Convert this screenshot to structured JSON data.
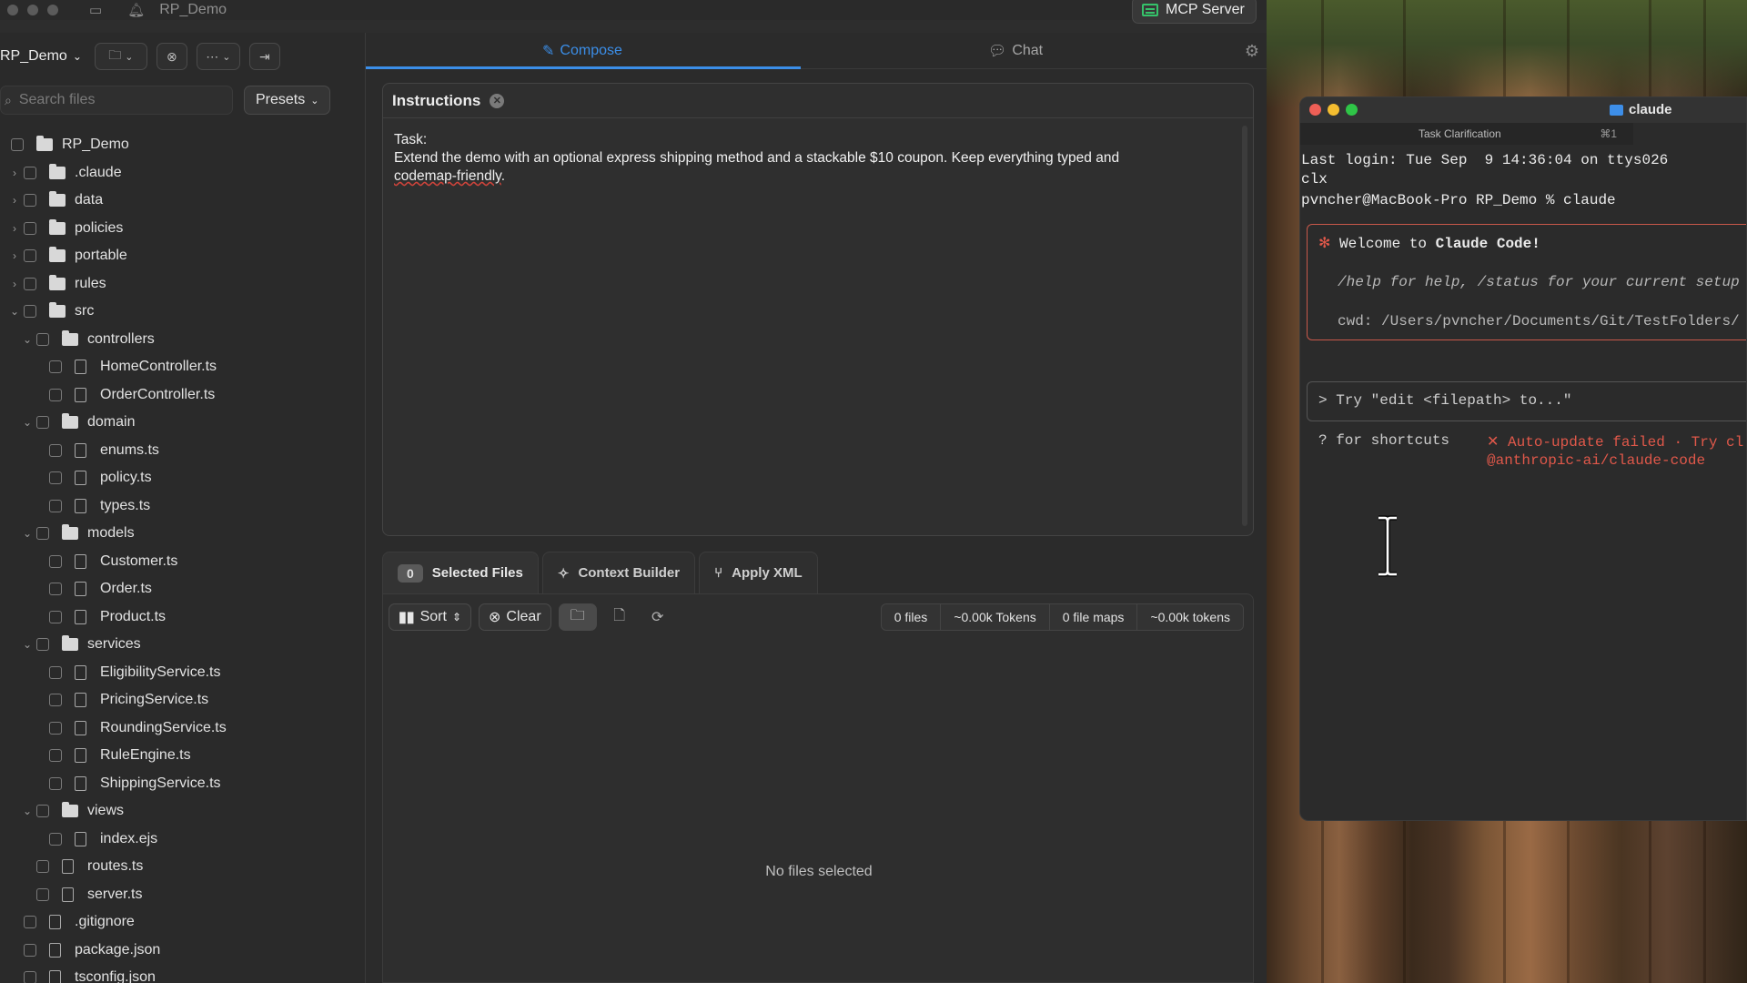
{
  "window": {
    "title": "RP_Demo",
    "mcp_label": "MCP Server"
  },
  "toolbar": {
    "project": "RP_Demo"
  },
  "search": {
    "placeholder": "Search files",
    "presets_label": "Presets"
  },
  "tree": [
    {
      "label": "RP_Demo",
      "type": "folder",
      "depth": 0,
      "expand": "",
      "top": 0
    },
    {
      "label": ".claude",
      "type": "folder",
      "depth": 1,
      "expand": "›"
    },
    {
      "label": "data",
      "type": "folder",
      "depth": 1,
      "expand": "›"
    },
    {
      "label": "policies",
      "type": "folder",
      "depth": 1,
      "expand": "›"
    },
    {
      "label": "portable",
      "type": "folder",
      "depth": 1,
      "expand": "›"
    },
    {
      "label": "rules",
      "type": "folder",
      "depth": 1,
      "expand": "›"
    },
    {
      "label": "src",
      "type": "folder",
      "depth": 1,
      "expand": "⌄"
    },
    {
      "label": "controllers",
      "type": "folder",
      "depth": 2,
      "expand": "⌄"
    },
    {
      "label": "HomeController.ts",
      "type": "file",
      "depth": 3,
      "expand": ""
    },
    {
      "label": "OrderController.ts",
      "type": "file",
      "depth": 3,
      "expand": ""
    },
    {
      "label": "domain",
      "type": "folder",
      "depth": 2,
      "expand": "⌄"
    },
    {
      "label": "enums.ts",
      "type": "file",
      "depth": 3,
      "expand": ""
    },
    {
      "label": "policy.ts",
      "type": "file",
      "depth": 3,
      "expand": ""
    },
    {
      "label": "types.ts",
      "type": "file",
      "depth": 3,
      "expand": ""
    },
    {
      "label": "models",
      "type": "folder",
      "depth": 2,
      "expand": "⌄"
    },
    {
      "label": "Customer.ts",
      "type": "file",
      "depth": 3,
      "expand": ""
    },
    {
      "label": "Order.ts",
      "type": "file",
      "depth": 3,
      "expand": ""
    },
    {
      "label": "Product.ts",
      "type": "file",
      "depth": 3,
      "expand": ""
    },
    {
      "label": "services",
      "type": "folder",
      "depth": 2,
      "expand": "⌄"
    },
    {
      "label": "EligibilityService.ts",
      "type": "file",
      "depth": 3,
      "expand": ""
    },
    {
      "label": "PricingService.ts",
      "type": "file",
      "depth": 3,
      "expand": ""
    },
    {
      "label": "RoundingService.ts",
      "type": "file",
      "depth": 3,
      "expand": ""
    },
    {
      "label": "RuleEngine.ts",
      "type": "file",
      "depth": 3,
      "expand": ""
    },
    {
      "label": "ShippingService.ts",
      "type": "file",
      "depth": 3,
      "expand": ""
    },
    {
      "label": "views",
      "type": "folder",
      "depth": 2,
      "expand": "⌄"
    },
    {
      "label": "index.ejs",
      "type": "file",
      "depth": 3,
      "expand": ""
    },
    {
      "label": "routes.ts",
      "type": "file",
      "depth": 2,
      "expand": ""
    },
    {
      "label": "server.ts",
      "type": "file",
      "depth": 2,
      "expand": ""
    },
    {
      "label": ".gitignore",
      "type": "file",
      "depth": 1,
      "expand": ""
    },
    {
      "label": "package.json",
      "type": "file",
      "depth": 1,
      "expand": ""
    },
    {
      "label": "tsconfig.json",
      "type": "file",
      "depth": 1,
      "expand": ""
    }
  ],
  "tabs": {
    "compose": "Compose",
    "chat": "Chat"
  },
  "instructions": {
    "title": "Instructions",
    "line1": "Task:",
    "line2": "Extend the demo with an optional express shipping method and a stackable $10 coupon. Keep everything typed and",
    "line3": "codemap-friendly",
    "line3_tail": "."
  },
  "bottom_tabs": {
    "selected_count": "0",
    "selected": "Selected Files",
    "context": "Context Builder",
    "apply": "Apply XML"
  },
  "files_toolbar": {
    "sort": "Sort",
    "clear": "Clear"
  },
  "stats": {
    "files": "0 files",
    "tokens": "~0.00k Tokens",
    "maps": "0 file maps",
    "tokens2": "~0.00k tokens"
  },
  "empty_label": "No files selected",
  "terminal": {
    "title": "claude",
    "tab": "Task Clarification",
    "tab_shortcut": "⌘1",
    "lines": {
      "login": "Last login: Tue Sep  9 14:36:04 on ttys026",
      "clx": "clx",
      "prompt": "pvncher@MacBook-Pro RP_Demo % claude",
      "welcome_star": "✻",
      "welcome": " Welcome to ",
      "welcome_bold": "Claude Code!",
      "help": "/help for help, /status for your current setup",
      "cwd": "cwd: /Users/pvncher/Documents/Git/TestFolders/",
      "try": "> Try \"edit <filepath> to...\"",
      "shortcuts": "? for shortcuts",
      "autoupdate": "✕ Auto-update failed · Try cl",
      "pkg": "@anthropic-ai/claude-code"
    }
  },
  "colors": {
    "accent": "#3b8ee8",
    "error": "#e0584a",
    "mcp_green": "#35c36a"
  }
}
